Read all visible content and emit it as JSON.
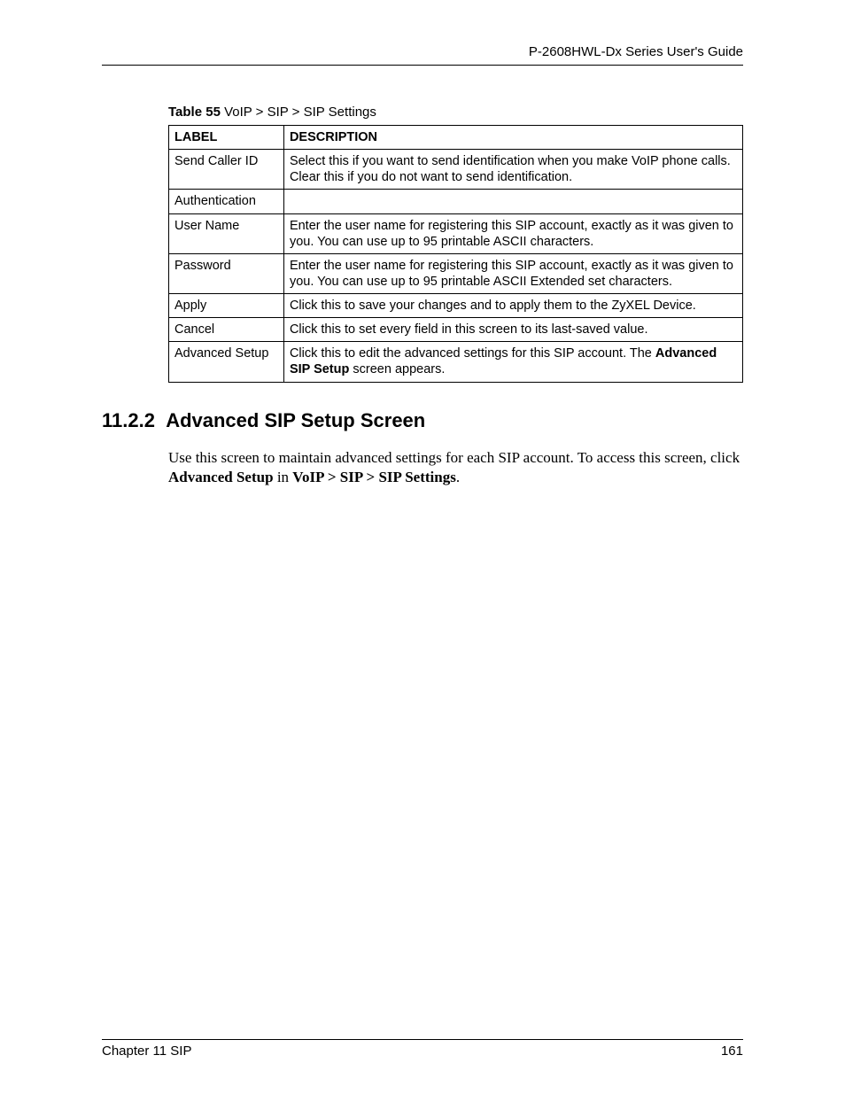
{
  "header": {
    "guide_title": "P-2608HWL-Dx Series User's Guide"
  },
  "table": {
    "caption_prefix": "Table 55",
    "caption_text": "   VoIP > SIP > SIP Settings",
    "head_label": "LABEL",
    "head_desc": "DESCRIPTION",
    "rows": [
      {
        "label": "Send Caller ID",
        "desc_html": "Select this if you want to send identification when you make VoIP phone calls. Clear this if you do not want to send identification."
      },
      {
        "label": "Authentication",
        "desc_html": ""
      },
      {
        "label": "User Name",
        "desc_html": "Enter the user name for registering this SIP account, exactly as it was given to you. You can use up to 95 printable ASCII characters."
      },
      {
        "label": "Password",
        "desc_html": "Enter the user name for registering this SIP account, exactly as it was given to you. You can use up to 95 printable ASCII Extended set characters."
      },
      {
        "label": "Apply",
        "desc_html": "Click this to save your changes and to apply them to the ZyXEL Device."
      },
      {
        "label": "Cancel",
        "desc_html": "Click this to set every field in this screen to its last-saved value."
      },
      {
        "label": "Advanced Setup",
        "desc_html": "Click this to edit the advanced settings for this SIP account. The <b>Advanced SIP Setup</b> screen appears."
      }
    ]
  },
  "section": {
    "number": "11.2.2",
    "title": "Advanced SIP Setup Screen",
    "paragraph_html": "Use this screen to maintain advanced settings for each SIP account. To access this screen, click <b>Advanced Setup</b> in <b>VoIP &gt; SIP &gt; SIP Settings</b>."
  },
  "footer": {
    "left": "Chapter 11 SIP",
    "right": "161"
  }
}
